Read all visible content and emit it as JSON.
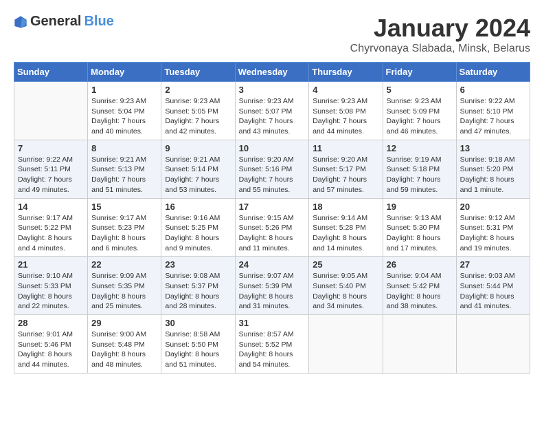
{
  "logo": {
    "general": "General",
    "blue": "Blue"
  },
  "header": {
    "month": "January 2024",
    "location": "Chyrvonaya Slabada, Minsk, Belarus"
  },
  "weekdays": [
    "Sunday",
    "Monday",
    "Tuesday",
    "Wednesday",
    "Thursday",
    "Friday",
    "Saturday"
  ],
  "weeks": [
    [
      {
        "day": "",
        "sunrise": "",
        "sunset": "",
        "daylight": ""
      },
      {
        "day": "1",
        "sunrise": "Sunrise: 9:23 AM",
        "sunset": "Sunset: 5:04 PM",
        "daylight": "Daylight: 7 hours and 40 minutes."
      },
      {
        "day": "2",
        "sunrise": "Sunrise: 9:23 AM",
        "sunset": "Sunset: 5:05 PM",
        "daylight": "Daylight: 7 hours and 42 minutes."
      },
      {
        "day": "3",
        "sunrise": "Sunrise: 9:23 AM",
        "sunset": "Sunset: 5:07 PM",
        "daylight": "Daylight: 7 hours and 43 minutes."
      },
      {
        "day": "4",
        "sunrise": "Sunrise: 9:23 AM",
        "sunset": "Sunset: 5:08 PM",
        "daylight": "Daylight: 7 hours and 44 minutes."
      },
      {
        "day": "5",
        "sunrise": "Sunrise: 9:23 AM",
        "sunset": "Sunset: 5:09 PM",
        "daylight": "Daylight: 7 hours and 46 minutes."
      },
      {
        "day": "6",
        "sunrise": "Sunrise: 9:22 AM",
        "sunset": "Sunset: 5:10 PM",
        "daylight": "Daylight: 7 hours and 47 minutes."
      }
    ],
    [
      {
        "day": "7",
        "sunrise": "Sunrise: 9:22 AM",
        "sunset": "Sunset: 5:11 PM",
        "daylight": "Daylight: 7 hours and 49 minutes."
      },
      {
        "day": "8",
        "sunrise": "Sunrise: 9:21 AM",
        "sunset": "Sunset: 5:13 PM",
        "daylight": "Daylight: 7 hours and 51 minutes."
      },
      {
        "day": "9",
        "sunrise": "Sunrise: 9:21 AM",
        "sunset": "Sunset: 5:14 PM",
        "daylight": "Daylight: 7 hours and 53 minutes."
      },
      {
        "day": "10",
        "sunrise": "Sunrise: 9:20 AM",
        "sunset": "Sunset: 5:16 PM",
        "daylight": "Daylight: 7 hours and 55 minutes."
      },
      {
        "day": "11",
        "sunrise": "Sunrise: 9:20 AM",
        "sunset": "Sunset: 5:17 PM",
        "daylight": "Daylight: 7 hours and 57 minutes."
      },
      {
        "day": "12",
        "sunrise": "Sunrise: 9:19 AM",
        "sunset": "Sunset: 5:18 PM",
        "daylight": "Daylight: 7 hours and 59 minutes."
      },
      {
        "day": "13",
        "sunrise": "Sunrise: 9:18 AM",
        "sunset": "Sunset: 5:20 PM",
        "daylight": "Daylight: 8 hours and 1 minute."
      }
    ],
    [
      {
        "day": "14",
        "sunrise": "Sunrise: 9:17 AM",
        "sunset": "Sunset: 5:22 PM",
        "daylight": "Daylight: 8 hours and 4 minutes."
      },
      {
        "day": "15",
        "sunrise": "Sunrise: 9:17 AM",
        "sunset": "Sunset: 5:23 PM",
        "daylight": "Daylight: 8 hours and 6 minutes."
      },
      {
        "day": "16",
        "sunrise": "Sunrise: 9:16 AM",
        "sunset": "Sunset: 5:25 PM",
        "daylight": "Daylight: 8 hours and 9 minutes."
      },
      {
        "day": "17",
        "sunrise": "Sunrise: 9:15 AM",
        "sunset": "Sunset: 5:26 PM",
        "daylight": "Daylight: 8 hours and 11 minutes."
      },
      {
        "day": "18",
        "sunrise": "Sunrise: 9:14 AM",
        "sunset": "Sunset: 5:28 PM",
        "daylight": "Daylight: 8 hours and 14 minutes."
      },
      {
        "day": "19",
        "sunrise": "Sunrise: 9:13 AM",
        "sunset": "Sunset: 5:30 PM",
        "daylight": "Daylight: 8 hours and 17 minutes."
      },
      {
        "day": "20",
        "sunrise": "Sunrise: 9:12 AM",
        "sunset": "Sunset: 5:31 PM",
        "daylight": "Daylight: 8 hours and 19 minutes."
      }
    ],
    [
      {
        "day": "21",
        "sunrise": "Sunrise: 9:10 AM",
        "sunset": "Sunset: 5:33 PM",
        "daylight": "Daylight: 8 hours and 22 minutes."
      },
      {
        "day": "22",
        "sunrise": "Sunrise: 9:09 AM",
        "sunset": "Sunset: 5:35 PM",
        "daylight": "Daylight: 8 hours and 25 minutes."
      },
      {
        "day": "23",
        "sunrise": "Sunrise: 9:08 AM",
        "sunset": "Sunset: 5:37 PM",
        "daylight": "Daylight: 8 hours and 28 minutes."
      },
      {
        "day": "24",
        "sunrise": "Sunrise: 9:07 AM",
        "sunset": "Sunset: 5:39 PM",
        "daylight": "Daylight: 8 hours and 31 minutes."
      },
      {
        "day": "25",
        "sunrise": "Sunrise: 9:05 AM",
        "sunset": "Sunset: 5:40 PM",
        "daylight": "Daylight: 8 hours and 34 minutes."
      },
      {
        "day": "26",
        "sunrise": "Sunrise: 9:04 AM",
        "sunset": "Sunset: 5:42 PM",
        "daylight": "Daylight: 8 hours and 38 minutes."
      },
      {
        "day": "27",
        "sunrise": "Sunrise: 9:03 AM",
        "sunset": "Sunset: 5:44 PM",
        "daylight": "Daylight: 8 hours and 41 minutes."
      }
    ],
    [
      {
        "day": "28",
        "sunrise": "Sunrise: 9:01 AM",
        "sunset": "Sunset: 5:46 PM",
        "daylight": "Daylight: 8 hours and 44 minutes."
      },
      {
        "day": "29",
        "sunrise": "Sunrise: 9:00 AM",
        "sunset": "Sunset: 5:48 PM",
        "daylight": "Daylight: 8 hours and 48 minutes."
      },
      {
        "day": "30",
        "sunrise": "Sunrise: 8:58 AM",
        "sunset": "Sunset: 5:50 PM",
        "daylight": "Daylight: 8 hours and 51 minutes."
      },
      {
        "day": "31",
        "sunrise": "Sunrise: 8:57 AM",
        "sunset": "Sunset: 5:52 PM",
        "daylight": "Daylight: 8 hours and 54 minutes."
      },
      {
        "day": "",
        "sunrise": "",
        "sunset": "",
        "daylight": ""
      },
      {
        "day": "",
        "sunrise": "",
        "sunset": "",
        "daylight": ""
      },
      {
        "day": "",
        "sunrise": "",
        "sunset": "",
        "daylight": ""
      }
    ]
  ]
}
